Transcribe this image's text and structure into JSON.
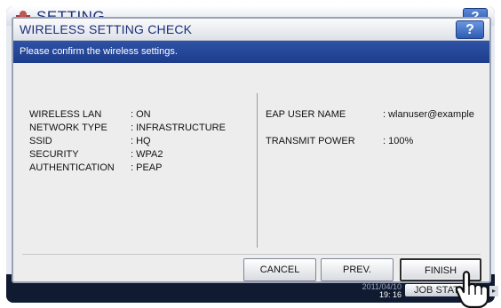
{
  "background": {
    "title": "SETTING",
    "help_label": "?",
    "clock": {
      "date": "2011/04/10",
      "time": "19: 16"
    },
    "job_status_label": "JOB STATUS",
    "arrow_label": "▸"
  },
  "dialog": {
    "title": "WIRELESS SETTING CHECK",
    "help_label": "?",
    "message": "Please confirm the wireless settings."
  },
  "settings_left": [
    {
      "label": "WIRELESS LAN",
      "value": ": ON"
    },
    {
      "label": "NETWORK TYPE",
      "value": ": INFRASTRUCTURE"
    },
    {
      "label": "SSID",
      "value": ": HQ"
    },
    {
      "label": "SECURITY",
      "value": ": WPA2"
    },
    {
      "label": "AUTHENTICATION",
      "value": ": PEAP"
    }
  ],
  "settings_right": [
    {
      "label": "EAP USER NAME",
      "value": ": wlanuser@example"
    },
    {
      "label": "TRANSMIT POWER",
      "value": ": 100%"
    }
  ],
  "buttons": {
    "cancel": "CANCEL",
    "prev": "PREV.",
    "finish": "FINISH"
  },
  "colors": {
    "accent_blue": "#1d3d8c",
    "title_text": "#1a2f78",
    "help_button": "#2d5bb1"
  },
  "icons": {
    "settings": "gear-icon",
    "help": "question-icon",
    "pointer": "hand-pointer-icon"
  }
}
